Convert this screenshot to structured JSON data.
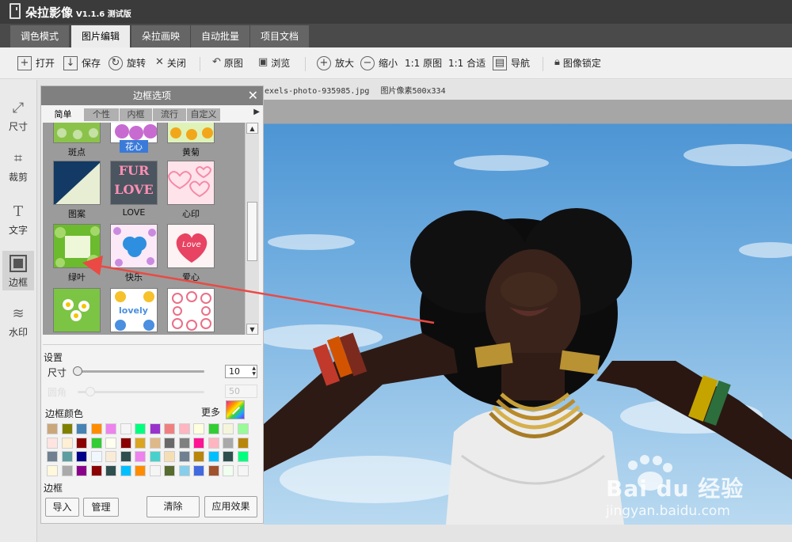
{
  "app": {
    "name": "朵拉影像",
    "version": "V1.1.6 测试版"
  },
  "tabs": [
    {
      "label": "调色模式",
      "active": false
    },
    {
      "label": "图片编辑",
      "active": true
    },
    {
      "label": "朵拉画映",
      "active": false
    },
    {
      "label": "自动批量",
      "active": false
    },
    {
      "label": "项目文档",
      "active": false
    }
  ],
  "toolbar": {
    "open": "打开",
    "save": "保存",
    "rotate": "旋转",
    "close": "关闭",
    "original": "原图",
    "browse": "浏览",
    "zoom_in": "放大",
    "zoom_out": "缩小",
    "actual_size": "1:1 原图",
    "fit": "1:1 合适",
    "navigator": "导航",
    "lock": "图像锁定"
  },
  "left_tools": [
    {
      "label": "尺寸",
      "icon": "resize-icon"
    },
    {
      "label": "裁剪",
      "icon": "crop-icon"
    },
    {
      "label": "文字",
      "icon": "text-icon"
    },
    {
      "label": "边框",
      "icon": "border-icon",
      "active": true
    },
    {
      "label": "水印",
      "icon": "watermark-icon"
    }
  ],
  "file_info": {
    "name": "exels-photo-935985.jpg",
    "pixels": "图片像素500x334"
  },
  "border_panel": {
    "title": "边框选项",
    "subtabs": [
      "简单",
      "个性",
      "内框",
      "流行",
      "自定义"
    ],
    "frames": [
      "斑点",
      "花心",
      "黄菊",
      "图案",
      "LOVE",
      "心印",
      "绿叶",
      "快乐",
      "爱心",
      "",
      "",
      ""
    ],
    "frame_texts": {
      "love_thumb": "FUR LOVE",
      "lovely": "lovely",
      "heart": "Love"
    },
    "settings_label": "设置",
    "size_label": "尺寸",
    "size_value": 10,
    "size_fraction": 0.0,
    "disabled_label": "圆角",
    "disabled_value": 50,
    "disabled_fraction": 0.1,
    "border_color_label": "边框颜色",
    "more_label": "更多",
    "palette": [
      [
        "#c9a77b",
        "#808000",
        "#4682b4",
        "#ff8c00",
        "#ee82ee",
        "#f5f5f5",
        "#00ff7f",
        "#9932cc",
        "#f08080",
        "#ffb6c1",
        "#ffffe0",
        "#32cd32",
        "#f5f5dc",
        "#98fb98"
      ],
      [
        "#ffe4e1",
        "#ffefd5",
        "#8b0000",
        "#32cd32",
        "#fffff0",
        "#8b0000",
        "#daa520",
        "#deb887",
        "#696969",
        "#808080",
        "#ff1493",
        "#ffb6c1",
        "#a9a9a9",
        "#b8860b"
      ],
      [
        "#708090",
        "#5f9ea0",
        "#00008b",
        "#f0f8ff",
        "#faebd7",
        "#2f4f4f",
        "#ee82ee",
        "#48d1cc",
        "#f5deb3",
        "#708090",
        "#b8860b",
        "#00bfff",
        "#2f4f4f",
        "#00ff7f"
      ],
      [
        "#fff8dc",
        "#a9a9a9",
        "#8b008b",
        "#8b0000",
        "#2f4f4f",
        "#00bfff",
        "#ff8c00",
        "#f5f5f5",
        "#556b2f",
        "#87ceeb",
        "#4169e1",
        "#a0522d",
        "#f0fff0",
        "#f5f5f5"
      ]
    ],
    "frame_label": "边框",
    "import_label": "导入",
    "manage_label": "管理",
    "clear_label": "清除",
    "apply_label": "应用效果"
  },
  "watermark": {
    "logo": "Bai du 经验",
    "url": "jingyan.baidu.com"
  },
  "colors": {
    "accent_arrow": "#ea4a43",
    "titlebar": "#3b3b3b",
    "tab_active": "#ececec"
  }
}
